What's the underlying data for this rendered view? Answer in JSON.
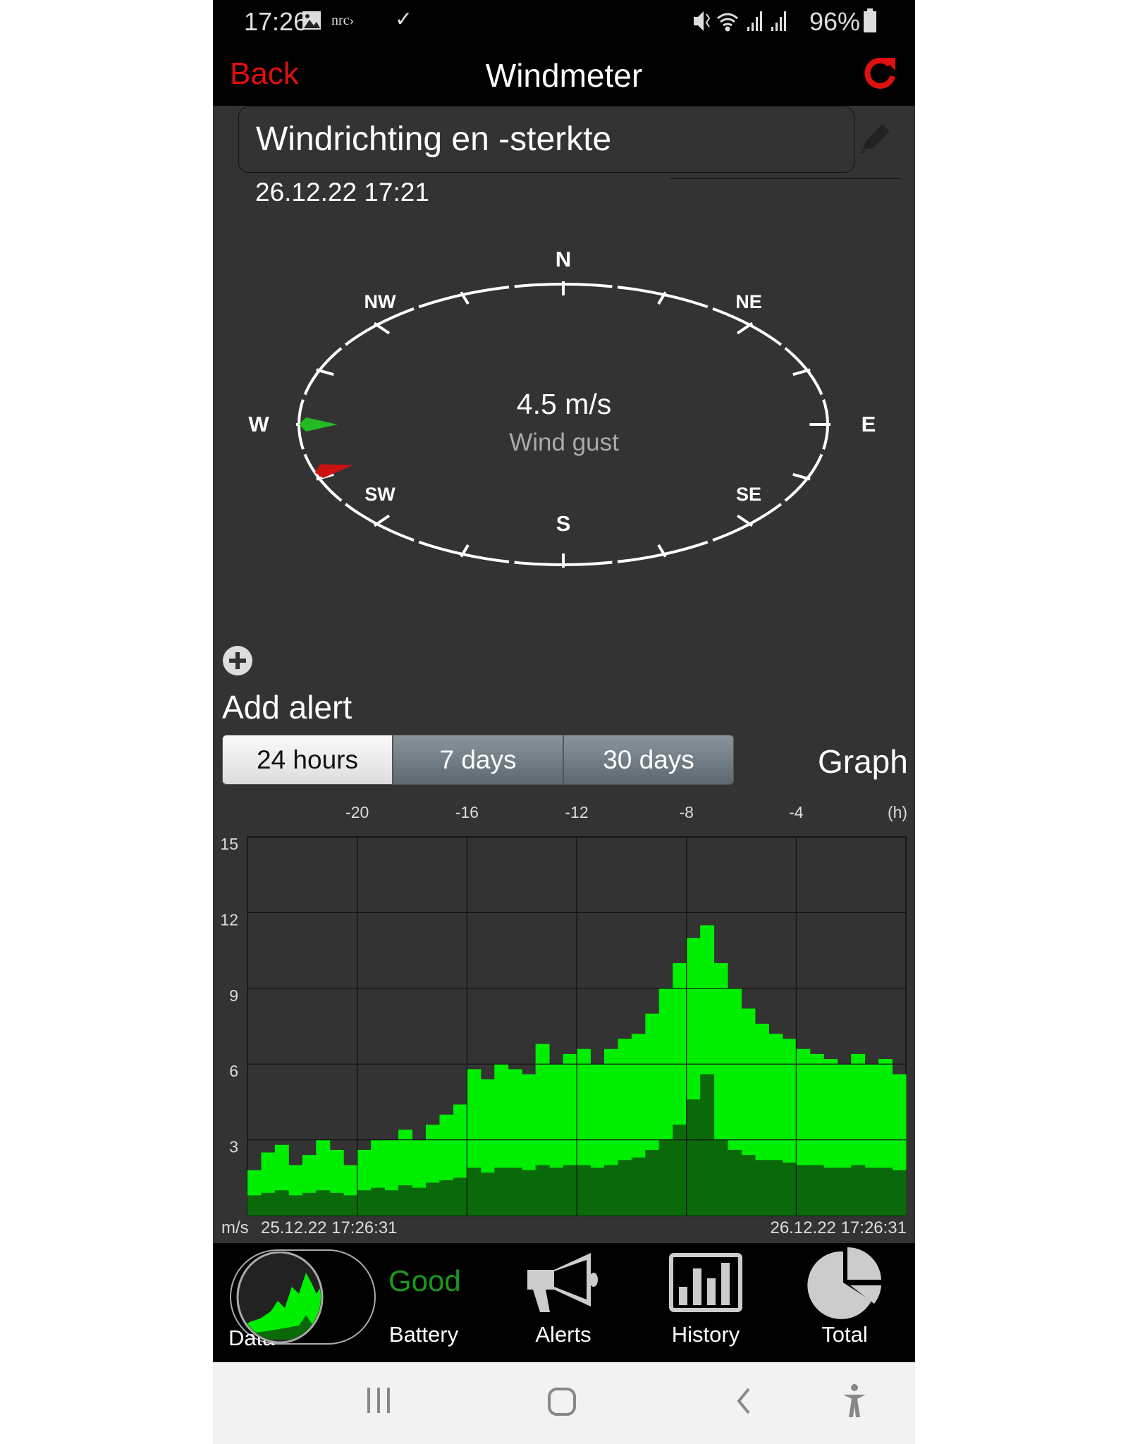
{
  "status_bar": {
    "time": "17:26",
    "notif_text": "nrc›",
    "battery": "96%",
    "icons": [
      "image-icon",
      "nrc-icon",
      "check-icon",
      "mute-icon",
      "wifi-icon",
      "signal-icon",
      "signal-icon",
      "battery-icon"
    ]
  },
  "nav": {
    "back": "Back",
    "title": "Windmeter",
    "refresh_icon": "refresh-icon"
  },
  "sensor": {
    "name": "Windrichting en -sterkte",
    "timestamp": "26.12.22  17:21"
  },
  "compass": {
    "labels": {
      "N": "N",
      "NE": "NE",
      "E": "E",
      "SE": "SE",
      "S": "S",
      "SW": "SW",
      "W": "W",
      "NW": "NW"
    },
    "speed": "4.5 m/s",
    "caption": "Wind gust",
    "green_arrow_deg": 270,
    "red_arrow_deg": 250,
    "colors": {
      "green": "#22bb22",
      "red": "#cc1111"
    }
  },
  "alert": {
    "label": "Add alert"
  },
  "range_tabs": [
    {
      "label": "24 hours",
      "active": true
    },
    {
      "label": "7 days",
      "active": false
    },
    {
      "label": "30 days",
      "active": false
    }
  ],
  "graph_label": "Graph",
  "chart_data": {
    "type": "bar",
    "x_unit_label": "(h)",
    "y_unit_label": "m/s",
    "x_ticks": [
      -20,
      -16,
      -12,
      -8,
      -4
    ],
    "y_ticks": [
      3,
      6,
      9,
      12,
      15
    ],
    "xlim": [
      -24,
      0
    ],
    "ylim": [
      0,
      15
    ],
    "grid": true,
    "start_label": "25.12.22  17:26:31",
    "end_label": "26.12.22  17:26:31",
    "x": [
      -24,
      -23.5,
      -23,
      -22.5,
      -22,
      -21.5,
      -21,
      -20.5,
      -20,
      -19.5,
      -19,
      -18.5,
      -18,
      -17.5,
      -17,
      -16.5,
      -16,
      -15.5,
      -15,
      -14.5,
      -14,
      -13.5,
      -13,
      -12.5,
      -12,
      -11.5,
      -11,
      -10.5,
      -10,
      -9.5,
      -9,
      -8.5,
      -8,
      -7.5,
      -7,
      -6.5,
      -6,
      -5.5,
      -5,
      -4.5,
      -4,
      -3.5,
      -3,
      -2.5,
      -2,
      -1.5,
      -1,
      -0.5
    ],
    "series": [
      {
        "color": "#00ee00",
        "values": [
          1.8,
          2.5,
          2.8,
          2.0,
          2.4,
          3.0,
          2.6,
          2.0,
          2.6,
          3.0,
          3.0,
          3.4,
          3.0,
          3.6,
          4.0,
          4.4,
          5.8,
          5.4,
          6.0,
          5.8,
          5.6,
          6.8,
          6.0,
          6.4,
          6.6,
          6.0,
          6.6,
          7.0,
          7.2,
          8.0,
          9.0,
          10.0,
          11.0,
          11.5,
          10.0,
          9.0,
          8.2,
          7.6,
          7.2,
          7.0,
          6.6,
          6.4,
          6.2,
          6.0,
          6.4,
          6.0,
          6.2,
          5.6
        ]
      },
      {
        "color": "#0a6a0a",
        "values": [
          0.8,
          0.9,
          1.0,
          0.8,
          0.9,
          1.0,
          0.9,
          0.8,
          1.0,
          1.1,
          1.0,
          1.2,
          1.1,
          1.3,
          1.4,
          1.5,
          1.9,
          1.7,
          1.9,
          1.9,
          1.8,
          2.0,
          1.9,
          2.0,
          2.0,
          1.9,
          2.0,
          2.2,
          2.3,
          2.6,
          3.0,
          3.6,
          4.6,
          5.6,
          3.0,
          2.6,
          2.4,
          2.2,
          2.2,
          2.1,
          2.0,
          2.0,
          1.9,
          1.9,
          2.0,
          1.9,
          1.9,
          1.8
        ]
      }
    ]
  },
  "bottom_nav": {
    "data_label": "Data",
    "battery_status": "Good",
    "battery_status_color": "#1a9a1a",
    "items": [
      {
        "label": "Battery"
      },
      {
        "label": "Alerts",
        "icon": "megaphone-icon"
      },
      {
        "label": "History",
        "icon": "bar-chart-icon"
      },
      {
        "label": "Total",
        "icon": "pie-chart-icon"
      }
    ]
  },
  "system_nav": [
    "recents-icon",
    "home-icon",
    "back-icon",
    "accessibility-icon"
  ]
}
